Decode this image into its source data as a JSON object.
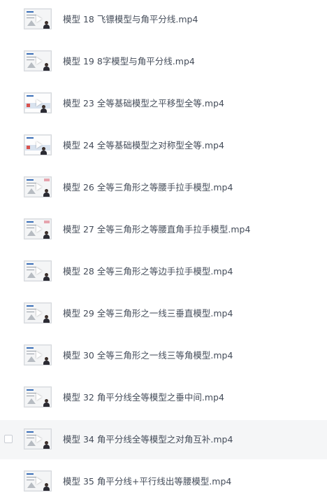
{
  "files": [
    {
      "name": "模型 18 飞镖模型与角平分线.mp4",
      "thumb_icon": "video-thumbnail-icon"
    },
    {
      "name": "模型 19 8字模型与角平分线.mp4",
      "thumb_icon": "video-thumbnail-icon"
    },
    {
      "name": "模型 23 全等基础模型之平移型全等.mp4",
      "thumb_icon": "video-thumbnail-icon"
    },
    {
      "name": "模型 24 全等基础模型之对称型全等.mp4",
      "thumb_icon": "video-thumbnail-icon"
    },
    {
      "name": "模型 26 全等三角形之等腰手拉手模型.mp4",
      "thumb_icon": "video-thumbnail-icon"
    },
    {
      "name": "模型 27 全等三角形之等腰直角手拉手模型.mp4",
      "thumb_icon": "video-thumbnail-icon"
    },
    {
      "name": "模型 28 全等三角形之等边手拉手模型.mp4",
      "thumb_icon": "video-thumbnail-icon"
    },
    {
      "name": "模型 29 全等三角形之一线三垂直模型.mp4",
      "thumb_icon": "video-thumbnail-icon"
    },
    {
      "name": "模型 30 全等三角形之一线三等角模型.mp4",
      "thumb_icon": "video-thumbnail-icon"
    },
    {
      "name": "模型 32 角平分线全等模型之垂中间.mp4",
      "thumb_icon": "video-thumbnail-icon"
    },
    {
      "name": "模型 34 角平分线全等模型之对角互补.mp4",
      "thumb_icon": "video-thumbnail-icon",
      "hovered": true
    },
    {
      "name": "模型 35 角平分线+平行线出等腰模型.mp4",
      "thumb_icon": "video-thumbnail-icon"
    }
  ],
  "colors": {
    "text": "#454d5a",
    "hover_background": "#f5f6f7",
    "checkbox_border": "#c9cdd4"
  }
}
